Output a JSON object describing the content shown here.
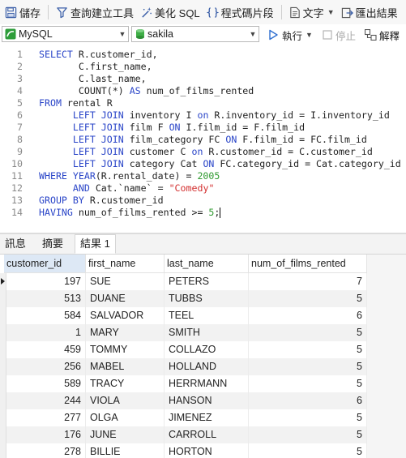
{
  "toolbar": {
    "save_label": "儲存",
    "query_builder_label": "查詢建立工具",
    "beautify_label": "美化 SQL",
    "snippet_label": "程式碼片段",
    "text_label": "文字",
    "export_label": "匯出結果"
  },
  "connection": {
    "server": "MySQL",
    "database": "sakila",
    "run_label": "執行",
    "stop_label": "停止",
    "explain_label": "解釋"
  },
  "editor": {
    "lines": [
      {
        "n": "1",
        "indent": "",
        "tokens": [
          {
            "t": "SELECT",
            "c": "kw"
          },
          {
            "t": " R.customer_id,",
            "c": ""
          }
        ]
      },
      {
        "n": "2",
        "indent": "       ",
        "tokens": [
          {
            "t": "C.first_name,",
            "c": ""
          }
        ]
      },
      {
        "n": "3",
        "indent": "       ",
        "tokens": [
          {
            "t": "C.last_name,",
            "c": ""
          }
        ]
      },
      {
        "n": "4",
        "indent": "       ",
        "tokens": [
          {
            "t": "COUNT(*) ",
            "c": ""
          },
          {
            "t": "AS",
            "c": "kw"
          },
          {
            "t": " num_of_films_rented",
            "c": ""
          }
        ]
      },
      {
        "n": "5",
        "indent": "",
        "tokens": [
          {
            "t": "FROM",
            "c": "kw"
          },
          {
            "t": " rental R",
            "c": ""
          }
        ]
      },
      {
        "n": "6",
        "indent": "      ",
        "tokens": [
          {
            "t": "LEFT JOIN",
            "c": "kw"
          },
          {
            "t": " inventory I ",
            "c": ""
          },
          {
            "t": "on",
            "c": "kw"
          },
          {
            "t": " R.inventory_id = I.inventory_id",
            "c": ""
          }
        ]
      },
      {
        "n": "7",
        "indent": "      ",
        "tokens": [
          {
            "t": "LEFT JOIN",
            "c": "kw"
          },
          {
            "t": " film F ",
            "c": ""
          },
          {
            "t": "ON",
            "c": "kw"
          },
          {
            "t": " I.film_id = F.film_id",
            "c": ""
          }
        ]
      },
      {
        "n": "8",
        "indent": "      ",
        "tokens": [
          {
            "t": "LEFT JOIN",
            "c": "kw"
          },
          {
            "t": " film_category FC ",
            "c": ""
          },
          {
            "t": "ON",
            "c": "kw"
          },
          {
            "t": " F.film_id = FC.film_id",
            "c": ""
          }
        ]
      },
      {
        "n": "9",
        "indent": "      ",
        "tokens": [
          {
            "t": "LEFT JOIN",
            "c": "kw"
          },
          {
            "t": " customer C ",
            "c": ""
          },
          {
            "t": "on",
            "c": "kw"
          },
          {
            "t": " R.customer_id = C.customer_id",
            "c": ""
          }
        ]
      },
      {
        "n": "10",
        "indent": "      ",
        "tokens": [
          {
            "t": "LEFT JOIN",
            "c": "kw"
          },
          {
            "t": " category Cat ",
            "c": ""
          },
          {
            "t": "ON",
            "c": "kw"
          },
          {
            "t": " FC.category_id = Cat.category_id",
            "c": ""
          }
        ]
      },
      {
        "n": "11",
        "indent": "",
        "tokens": [
          {
            "t": "WHERE",
            "c": "kw"
          },
          {
            "t": " ",
            "c": ""
          },
          {
            "t": "YEAR",
            "c": "kw"
          },
          {
            "t": "(R.rental_date) = ",
            "c": ""
          },
          {
            "t": "2005",
            "c": "num"
          }
        ]
      },
      {
        "n": "12",
        "indent": "      ",
        "tokens": [
          {
            "t": "AND",
            "c": "kw"
          },
          {
            "t": " Cat.`name` = ",
            "c": ""
          },
          {
            "t": "\"Comedy\"",
            "c": "str"
          }
        ]
      },
      {
        "n": "13",
        "indent": "",
        "tokens": [
          {
            "t": "GROUP BY",
            "c": "kw"
          },
          {
            "t": " R.customer_id",
            "c": ""
          }
        ]
      },
      {
        "n": "14",
        "indent": "",
        "tokens": [
          {
            "t": "HAVING",
            "c": "kw"
          },
          {
            "t": " num_of_films_rented >= ",
            "c": ""
          },
          {
            "t": "5",
            "c": "num"
          },
          {
            "t": ";",
            "c": ""
          }
        ]
      }
    ]
  },
  "tabs": [
    {
      "label": "訊息",
      "active": false
    },
    {
      "label": "摘要",
      "active": false
    },
    {
      "label": "結果 1",
      "active": true
    }
  ],
  "grid": {
    "columns": [
      "customer_id",
      "first_name",
      "last_name",
      "num_of_films_rented"
    ],
    "rows": [
      [
        "197",
        "SUE",
        "PETERS",
        "7"
      ],
      [
        "513",
        "DUANE",
        "TUBBS",
        "5"
      ],
      [
        "584",
        "SALVADOR",
        "TEEL",
        "6"
      ],
      [
        "1",
        "MARY",
        "SMITH",
        "5"
      ],
      [
        "459",
        "TOMMY",
        "COLLAZO",
        "5"
      ],
      [
        "256",
        "MABEL",
        "HOLLAND",
        "5"
      ],
      [
        "589",
        "TRACY",
        "HERRMANN",
        "5"
      ],
      [
        "244",
        "VIOLA",
        "HANSON",
        "6"
      ],
      [
        "277",
        "OLGA",
        "JIMENEZ",
        "5"
      ],
      [
        "176",
        "JUNE",
        "CARROLL",
        "5"
      ],
      [
        "278",
        "BILLIE",
        "HORTON",
        "5"
      ]
    ]
  },
  "colors": {
    "keyword": "#2a45c8",
    "number": "#2f9a2f",
    "string": "#d32f2f",
    "sorted_header": "#dde8f5"
  }
}
